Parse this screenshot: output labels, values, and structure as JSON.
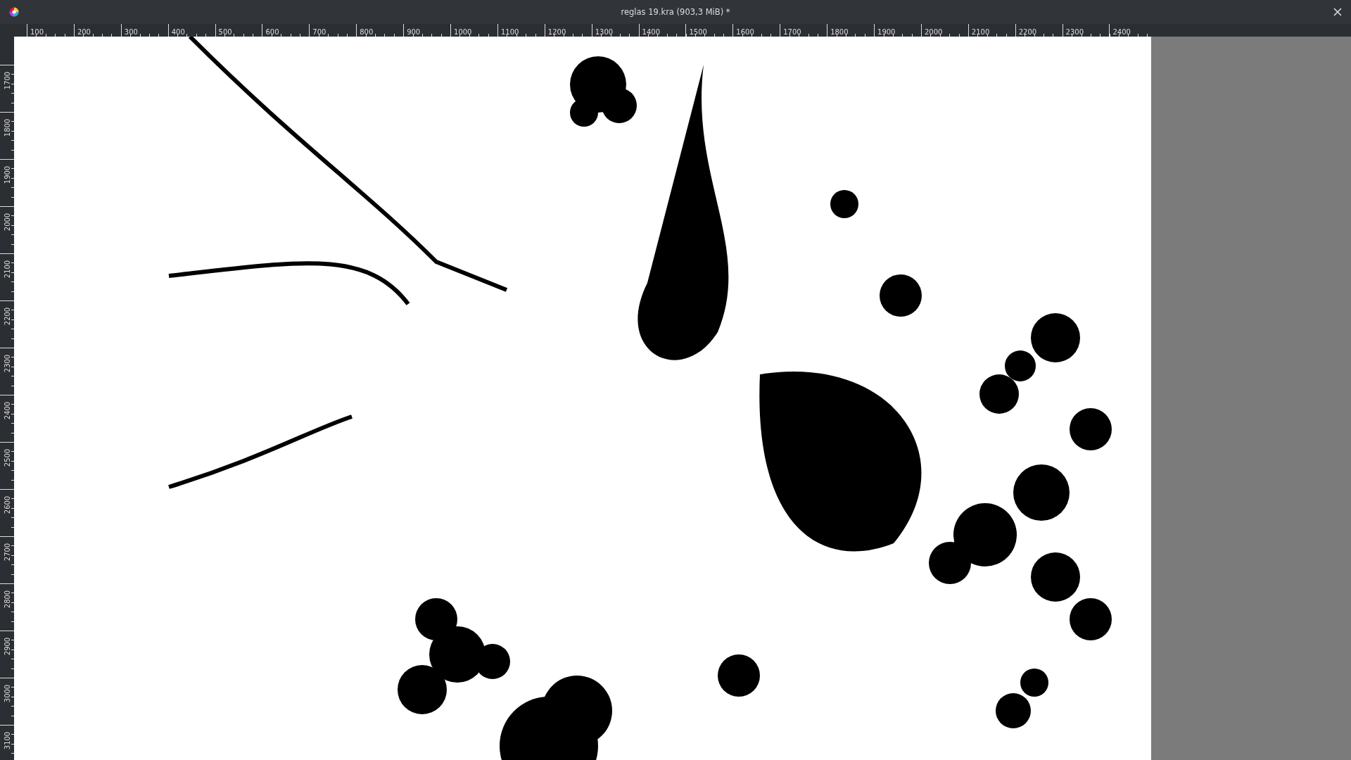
{
  "window": {
    "title": "reglas 19.kra (903,3 MiB) *"
  },
  "horizontal_ruler": {
    "labels": [
      "100",
      "200",
      "300",
      "400",
      "500",
      "600",
      "700",
      "800",
      "900",
      "1000",
      "1100",
      "1200",
      "1300",
      "1400",
      "1500",
      "1600",
      "1700",
      "1800",
      "1900",
      "2000",
      "2100",
      "2200",
      "2300",
      "2400"
    ]
  },
  "vertical_ruler": {
    "labels": [
      "1700",
      "1800",
      "1900",
      "2000",
      "2100",
      "2200",
      "2300",
      "2400",
      "2500",
      "2600",
      "2700",
      "2800",
      "2900",
      "3000",
      "3100"
    ]
  }
}
